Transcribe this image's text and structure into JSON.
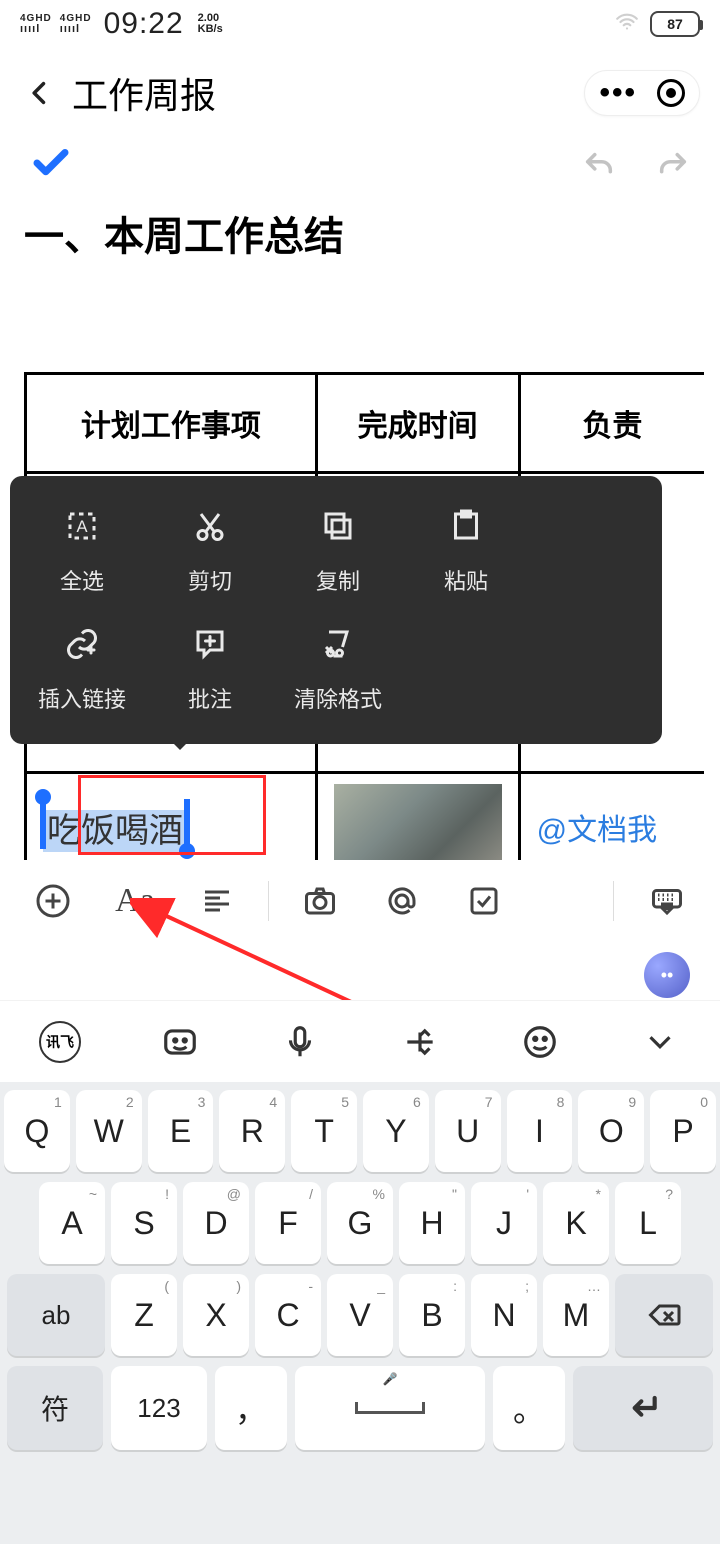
{
  "status": {
    "signal1": "4GHD",
    "signal2": "4GHD",
    "time": "09:22",
    "netspeed_top": "2.00",
    "netspeed_bottom": "KB/s",
    "battery": "87"
  },
  "header": {
    "title": "工作周报",
    "more": "•••"
  },
  "doc": {
    "heading": "一、本周工作总结",
    "table": {
      "headers": [
        "计划工作事项",
        "完成时间",
        "负责"
      ],
      "selected_text": "吃饭喝酒",
      "mention": "@文档我"
    }
  },
  "context_menu": {
    "items": [
      {
        "id": "select-all",
        "label": "全选"
      },
      {
        "id": "cut",
        "label": "剪切"
      },
      {
        "id": "copy",
        "label": "复制"
      },
      {
        "id": "paste",
        "label": "粘贴"
      },
      {
        "id": "link",
        "label": "插入链接"
      },
      {
        "id": "comment",
        "label": "批注"
      },
      {
        "id": "clear-fmt",
        "label": "清除格式"
      }
    ]
  },
  "toolbar": {
    "aa": "Aa"
  },
  "ime": {
    "brand": "讯飞"
  },
  "keyboard": {
    "row1": [
      {
        "sup": "1",
        "main": "Q"
      },
      {
        "sup": "2",
        "main": "W"
      },
      {
        "sup": "3",
        "main": "E"
      },
      {
        "sup": "4",
        "main": "R"
      },
      {
        "sup": "5",
        "main": "T"
      },
      {
        "sup": "6",
        "main": "Y"
      },
      {
        "sup": "7",
        "main": "U"
      },
      {
        "sup": "8",
        "main": "I"
      },
      {
        "sup": "9",
        "main": "O"
      },
      {
        "sup": "0",
        "main": "P"
      }
    ],
    "row2": [
      {
        "sup": "~",
        "main": "A"
      },
      {
        "sup": "!",
        "main": "S"
      },
      {
        "sup": "@",
        "main": "D"
      },
      {
        "sup": "/",
        "main": "F"
      },
      {
        "sup": "%",
        "main": "G"
      },
      {
        "sup": "\"",
        "main": "H"
      },
      {
        "sup": "'",
        "main": "J"
      },
      {
        "sup": "*",
        "main": "K"
      },
      {
        "sup": "?",
        "main": "L"
      }
    ],
    "row3_shift": "ab",
    "row3": [
      {
        "sup": "(",
        "main": "Z"
      },
      {
        "sup": ")",
        "main": "X"
      },
      {
        "sup": "-",
        "main": "C"
      },
      {
        "sup": "_",
        "main": "V"
      },
      {
        "sup": ":",
        "main": "B"
      },
      {
        "sup": ";",
        "main": "N"
      },
      {
        "sup": "…",
        "main": "M"
      }
    ],
    "row4": {
      "sym": "符",
      "num": "123",
      "comma": "，",
      "period": "。"
    }
  }
}
